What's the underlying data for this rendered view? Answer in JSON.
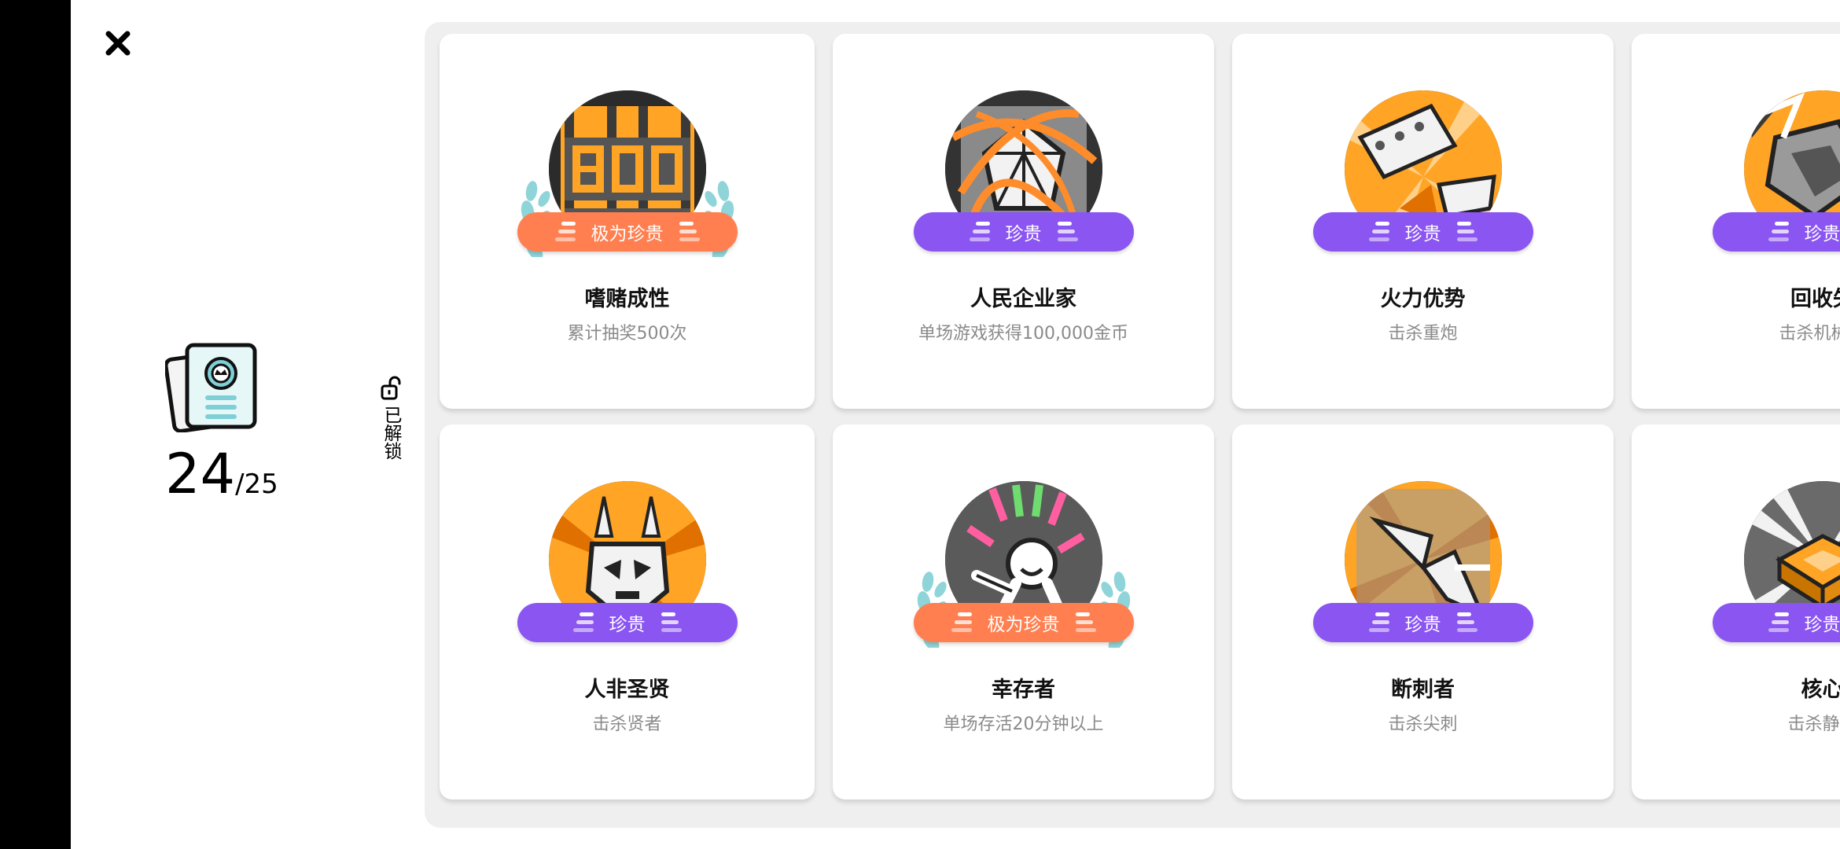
{
  "header": {
    "close_icon": "close-icon"
  },
  "summary": {
    "icon": "achievement-card-icon",
    "unlocked_count": "24",
    "total_count": "/25"
  },
  "filter": {
    "icon": "unlock-icon",
    "label": "已解锁"
  },
  "colors": {
    "epic": "#ff7f50",
    "rare": "#8b55f2",
    "orange": "#ffa424",
    "laurel": "#8fd4d8"
  },
  "achievements": [
    {
      "title": "嗜赌成性",
      "description": "累计抽奖500次",
      "rarity": "极为珍贵",
      "art": "slot-500-art"
    },
    {
      "title": "人民企业家",
      "description": "单场游戏获得100,000金币",
      "rarity": "珍贵",
      "art": "diamond-art"
    },
    {
      "title": "火力优势",
      "description": "击杀重炮",
      "rarity": "珍贵",
      "art": "cannon-art"
    },
    {
      "title": "回收失",
      "description": "击杀机械回",
      "rarity": "珍贵",
      "art": "mech-art"
    },
    {
      "title": "人非圣贤",
      "description": "击杀贤者",
      "rarity": "珍贵",
      "art": "skull-art"
    },
    {
      "title": "幸存者",
      "description": "单场存活20分钟以上",
      "rarity": "极为珍贵",
      "art": "survivor-art"
    },
    {
      "title": "断刺者",
      "description": "击杀尖刺",
      "rarity": "珍贵",
      "art": "spike-art"
    },
    {
      "title": "核心",
      "description": "击杀静滞",
      "rarity": "珍贵",
      "art": "core-art"
    }
  ]
}
